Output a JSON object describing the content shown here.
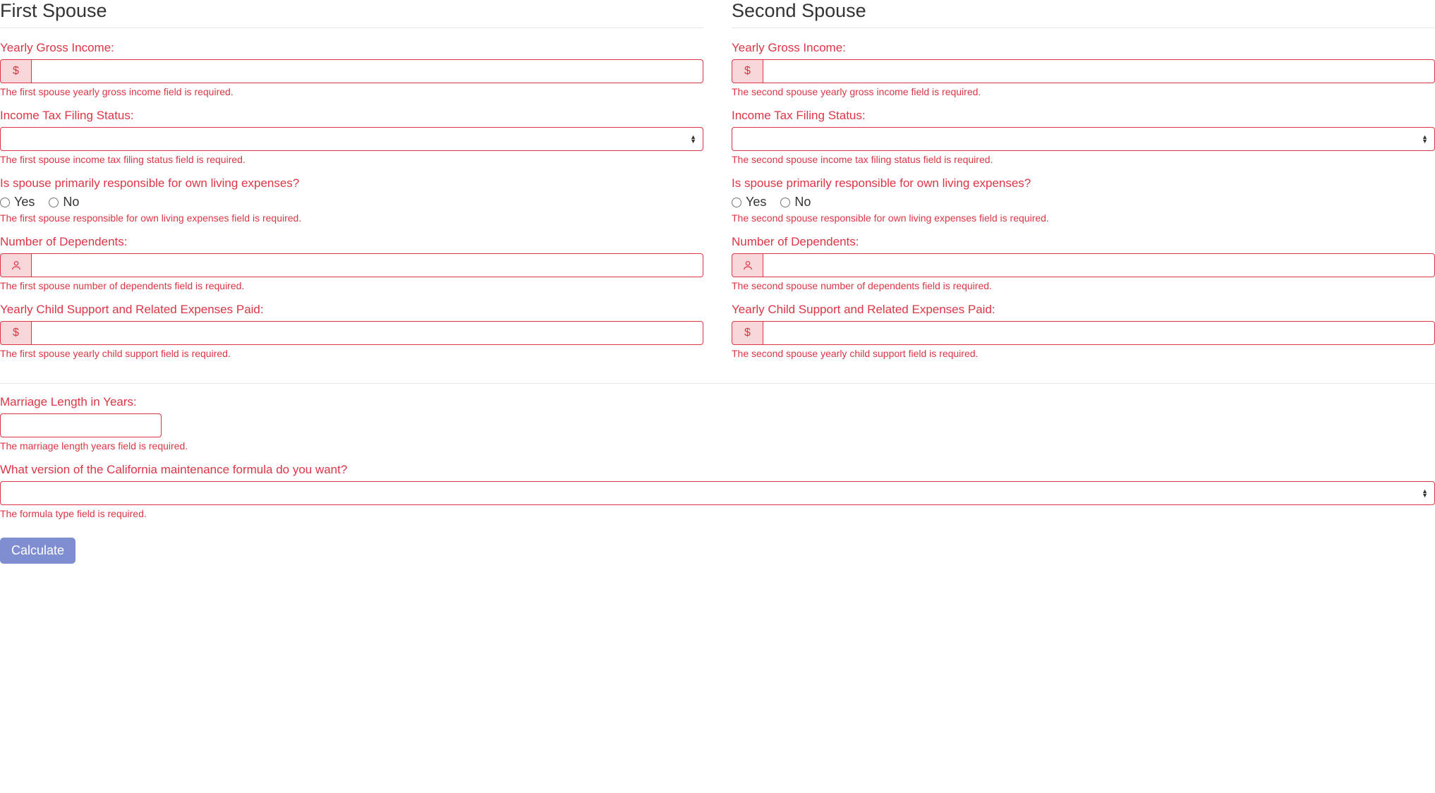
{
  "spouse1": {
    "title": "First Spouse",
    "income_label": "Yearly Gross Income:",
    "income_error": "The first spouse yearly gross income field is required.",
    "filing_label": "Income Tax Filing Status:",
    "filing_error": "The first spouse income tax filing status field is required.",
    "expenses_label": "Is spouse primarily responsible for own living expenses?",
    "expenses_error": "The first spouse responsible for own living expenses field is required.",
    "dependents_label": "Number of Dependents:",
    "dependents_error": "The first spouse number of dependents field is required.",
    "child_support_label": "Yearly Child Support and Related Expenses Paid:",
    "child_support_error": "The first spouse yearly child support field is required."
  },
  "spouse2": {
    "title": "Second Spouse",
    "income_label": "Yearly Gross Income:",
    "income_error": "The second spouse yearly gross income field is required.",
    "filing_label": "Income Tax Filing Status:",
    "filing_error": "The second spouse income tax filing status field is required.",
    "expenses_label": "Is spouse primarily responsible for own living expenses?",
    "expenses_error": "The second spouse responsible for own living expenses field is required.",
    "dependents_label": "Number of Dependents:",
    "dependents_error": "The second spouse number of dependents field is required.",
    "child_support_label": "Yearly Child Support and Related Expenses Paid:",
    "child_support_error": "The second spouse yearly child support field is required."
  },
  "options": {
    "yes": "Yes",
    "no": "No"
  },
  "bottom": {
    "marriage_label": "Marriage Length in Years:",
    "marriage_error": "The marriage length years field is required.",
    "formula_label": "What version of the California maintenance formula do you want?",
    "formula_error": "The formula type field is required."
  },
  "icons": {
    "dollar": "$"
  },
  "buttons": {
    "calculate": "Calculate"
  }
}
